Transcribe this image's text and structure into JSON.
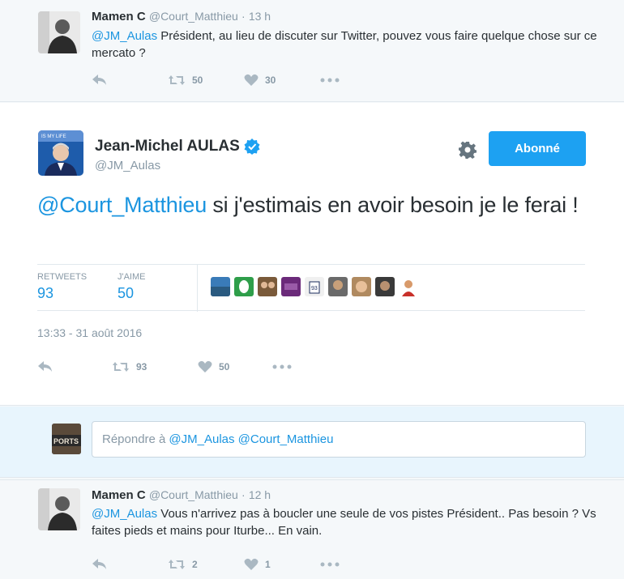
{
  "colors": {
    "link": "#1b95e0",
    "follow_button": "#1da1f2",
    "muted": "#8899a6",
    "reply_bg": "#e8f5fd"
  },
  "tweet_top": {
    "name": "Mamen C",
    "handle": "@Court_Matthieu",
    "separator": "·",
    "time": "13 h",
    "mention": "@JM_Aulas",
    "text": " Président, au lieu de discuter sur Twitter, pouvez vous faire quelque chose sur ce mercato ?",
    "retweets": "50",
    "likes": "30",
    "icons": [
      "reply-icon",
      "retweet-icon",
      "heart-icon",
      "more-icon"
    ]
  },
  "main_tweet": {
    "name": "Jean-Michel AULAS",
    "handle": "@JM_Aulas",
    "avatar_caption": "IS MY LIFE",
    "follow_label": "Abonné",
    "mention": "@Court_Matthieu",
    "text": " si j'estimais en avoir besoin je le ferai !",
    "retweets_label": "RETWEETS",
    "retweets": "93",
    "likes_label": "J'AIME",
    "likes": "50",
    "timestamp": "13:33 - 31 août 2016",
    "action_retweets": "93",
    "action_likes": "50",
    "icons": [
      "verified-icon",
      "gear-icon",
      "reply-icon",
      "retweet-icon",
      "heart-icon",
      "more-icon"
    ]
  },
  "reply_box": {
    "avatar_caption": "PORTS",
    "prefix": "Répondre à",
    "mentions": "@JM_Aulas @Court_Matthieu"
  },
  "tweet_bottom": {
    "name": "Mamen C",
    "handle": "@Court_Matthieu",
    "separator": "·",
    "time": "12 h",
    "mention": "@JM_Aulas",
    "text": " Vous n'arrivez pas à boucler une seule de vos pistes Président.. Pas besoin ? Vs faites pieds et mains pour Iturbe... En vain.",
    "retweets": "2",
    "likes": "1"
  }
}
